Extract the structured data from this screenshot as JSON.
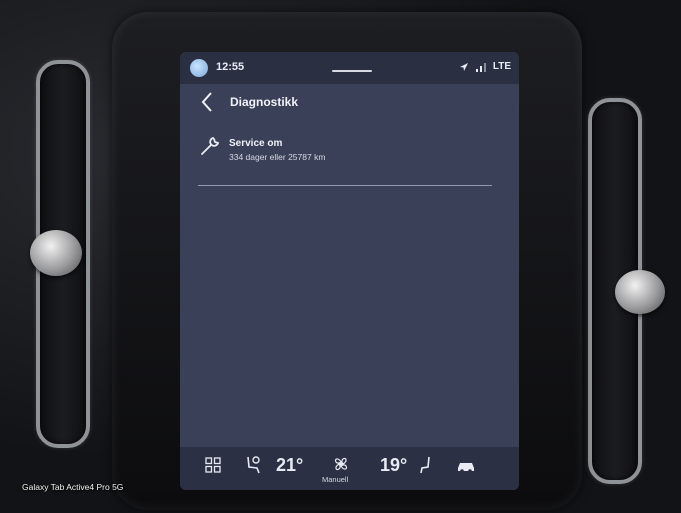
{
  "status_bar": {
    "time": "12:55",
    "network": "LTE"
  },
  "header": {
    "title": "Diagnostikk"
  },
  "service_item": {
    "title": "Service om",
    "subtitle": "334 dager eller 25787 km"
  },
  "climate_bar": {
    "temp_left": "21°",
    "fan_mode": "Manuell",
    "temp_right": "19°"
  },
  "watermark": {
    "device": "Galaxy Tab Active4 Pro 5G"
  },
  "icons": [
    "status-avatar-icon",
    "navigation-arrow-icon",
    "signal-icon",
    "back-chevron-icon",
    "wrench-icon",
    "apps-grid-icon",
    "seat-heat-left-icon",
    "fan-icon",
    "seat-right-icon",
    "car-icon"
  ],
  "colors": {
    "screen_background": "#3a4057",
    "bar_background": "#2b3044",
    "text": "#f0f2f8"
  }
}
